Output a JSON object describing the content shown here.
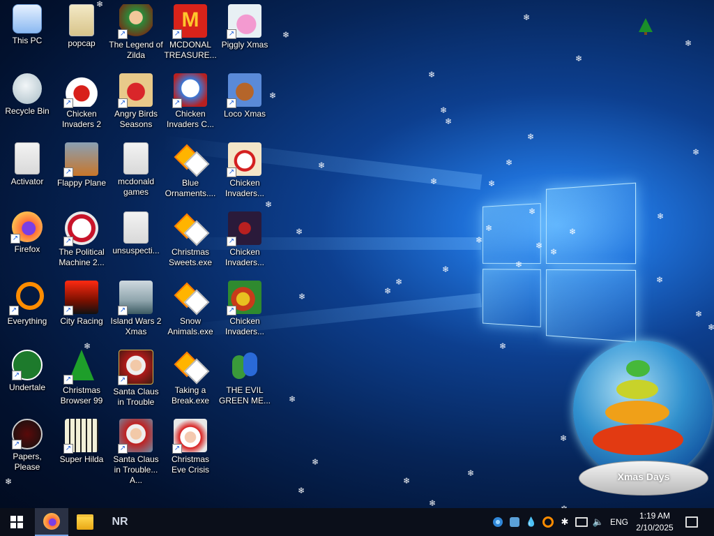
{
  "desktop_icons": [
    {
      "label": "This PC",
      "icon": "this-pc-icon",
      "shortcut": false
    },
    {
      "label": "popcap",
      "icon": "folder-icon",
      "shortcut": false
    },
    {
      "label": "The Legend of Zilda",
      "icon": "legend-of-zilda-icon",
      "shortcut": true
    },
    {
      "label": "MCDONAL TREASURE...",
      "icon": "mcdonalds-icon",
      "shortcut": true
    },
    {
      "label": "Piggly Xmas",
      "icon": "piggly-xmas-icon",
      "shortcut": true
    },
    {
      "label": "Recycle Bin",
      "icon": "recycle-bin-icon",
      "shortcut": false
    },
    {
      "label": "Chicken Invaders 2",
      "icon": "chicken-invaders-2-icon",
      "shortcut": true
    },
    {
      "label": "Angry Birds Seasons",
      "icon": "angry-birds-icon",
      "shortcut": true
    },
    {
      "label": "Chicken Invaders C...",
      "icon": "snowman-icon",
      "shortcut": true
    },
    {
      "label": "Loco Xmas",
      "icon": "loco-xmas-icon",
      "shortcut": true
    },
    {
      "label": "Activator",
      "icon": "file-icon",
      "shortcut": false
    },
    {
      "label": "Flappy Plane",
      "icon": "flappy-plane-icon",
      "shortcut": true
    },
    {
      "label": "mcdonald games",
      "icon": "folder-icon",
      "shortcut": false
    },
    {
      "label": "Blue Ornaments....",
      "icon": "installer-icon",
      "shortcut": false
    },
    {
      "label": "Chicken Invaders...",
      "icon": "chicken-invaders-icon",
      "shortcut": true
    },
    {
      "label": "Firefox",
      "icon": "firefox-icon",
      "shortcut": true
    },
    {
      "label": "The Political Machine 2...",
      "icon": "political-machine-icon",
      "shortcut": true
    },
    {
      "label": "unsuspecti...",
      "icon": "file-icon",
      "shortcut": false
    },
    {
      "label": "Christmas Sweets.exe",
      "icon": "installer-icon",
      "shortcut": false
    },
    {
      "label": "Chicken Invaders...",
      "icon": "chicken-invaders-icon",
      "shortcut": true
    },
    {
      "label": "Everything",
      "icon": "everything-search-icon",
      "shortcut": true
    },
    {
      "label": "City Racing",
      "icon": "city-racing-icon",
      "shortcut": true
    },
    {
      "label": "Island Wars 2 Xmas",
      "icon": "island-wars-icon",
      "shortcut": true
    },
    {
      "label": "Snow Animals.exe",
      "icon": "installer-icon",
      "shortcut": false
    },
    {
      "label": "Chicken Invaders...",
      "icon": "chicken-invaders-icon",
      "shortcut": true
    },
    {
      "label": "Undertale",
      "icon": "undertale-icon",
      "shortcut": true
    },
    {
      "label": "Christmas Browser 99",
      "icon": "christmas-tree-icon",
      "shortcut": true
    },
    {
      "label": "Santa Claus in Trouble",
      "icon": "santa-claus-icon",
      "shortcut": true
    },
    {
      "label": "Taking a Break.exe",
      "icon": "installer-icon",
      "shortcut": false
    },
    {
      "label": "THE EVIL GREEN ME...",
      "icon": "msn-messenger-icon",
      "shortcut": false
    },
    {
      "label": "Papers, Please",
      "icon": "papers-please-icon",
      "shortcut": true
    },
    {
      "label": "Super Hilda",
      "icon": "super-hilda-icon",
      "shortcut": true
    },
    {
      "label": "Santa Claus in Trouble... A...",
      "icon": "santa-claus-icon",
      "shortcut": true
    },
    {
      "label": "Christmas Eve Crisis",
      "icon": "santa-face-icon",
      "shortcut": true
    }
  ],
  "snow_globe": {
    "text": "Xmas Days"
  },
  "taskbar": {
    "start": "start-icon",
    "pinned": [
      {
        "name": "firefox-icon",
        "active": true
      },
      {
        "name": "file-explorer-icon",
        "active": false
      },
      {
        "name": "nr-app",
        "label": "NR",
        "active": false
      }
    ],
    "tray": {
      "language": "ENG",
      "time": "1:19 AM",
      "date": "2/10/2025"
    }
  },
  "colors": {
    "taskbar": "#0b0f1a",
    "accent": "#1e6fd6"
  }
}
